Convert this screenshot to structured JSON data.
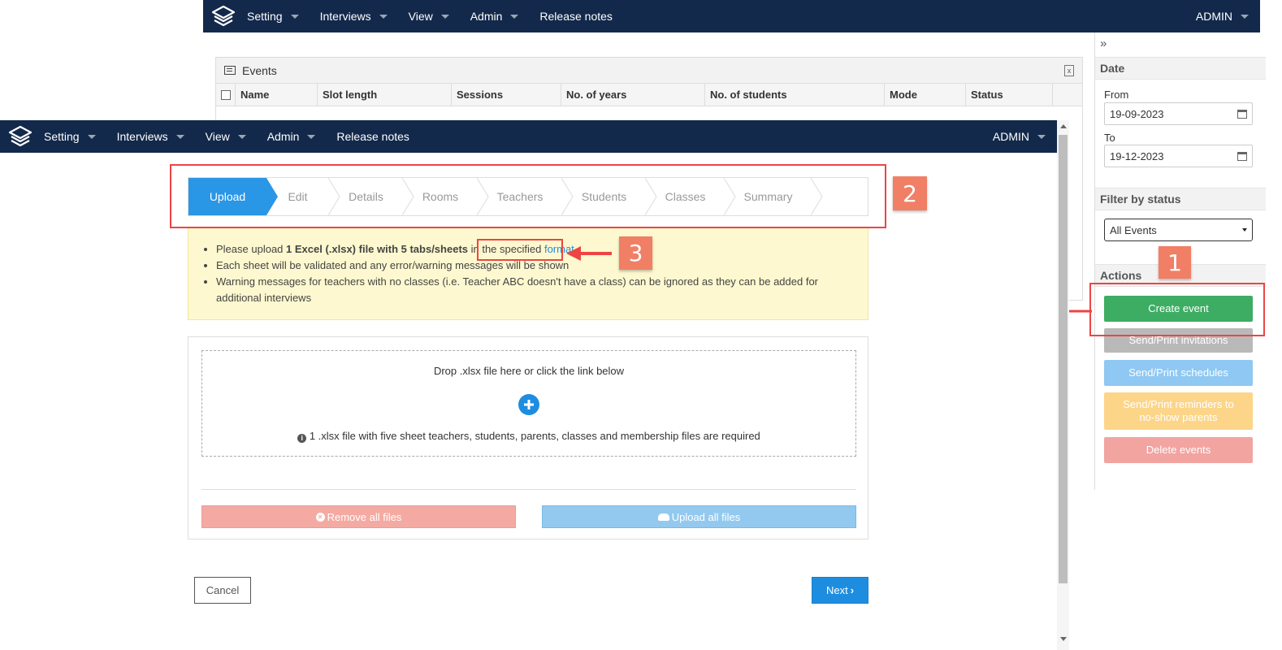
{
  "nav": {
    "items": [
      "Setting",
      "Interviews",
      "View",
      "Admin",
      "Release notes"
    ],
    "admin_label": "ADMIN"
  },
  "events": {
    "title": "Events",
    "columns": [
      "Name",
      "Slot length",
      "Sessions",
      "No. of years",
      "No. of students",
      "Mode",
      "Status"
    ]
  },
  "sidebar": {
    "collapse_glyph": "»",
    "date_heading": "Date",
    "from_label": "From",
    "from_value": "19-09-2023",
    "to_label": "To",
    "to_value": "19-12-2023",
    "filter_heading": "Filter by status",
    "filter_value": "All Events",
    "actions_heading": "Actions",
    "buttons": {
      "create": "Create event",
      "invitations": "Send/Print invitations",
      "schedules": "Send/Print schedules",
      "reminders": "Send/Print reminders to no-show parents",
      "delete": "Delete events"
    },
    "colors": {
      "create": "#3dad63",
      "invitations": "#b9b9b9",
      "schedules": "#8fc8f2",
      "reminders": "#fcd589",
      "delete": "#f2a4a1"
    }
  },
  "wizard": {
    "steps": [
      "Upload",
      "Edit",
      "Details",
      "Rooms",
      "Teachers",
      "Students",
      "Classes",
      "Summary"
    ],
    "active_step": "Upload"
  },
  "notice": {
    "line1_prefix": "Please upload ",
    "line1_bold": "1 Excel (.xlsx) file with 5 tabs/sheets",
    "line1_mid": " in the specified ",
    "line1_link": "format",
    "line2": "Each sheet will be validated and any error/warning messages will be shown",
    "line3": "Warning messages for teachers with no classes (i.e. Teacher ABC doesn't have a class) can be ignored as they can be added for additional interviews"
  },
  "upload": {
    "drop_text": "Drop .xlsx file here or click the link below",
    "info_text": "1 .xlsx file with five sheet teachers, students, parents, classes and membership files are required",
    "remove_label": "Remove all files",
    "upload_label": "Upload all files"
  },
  "footer": {
    "cancel_label": "Cancel",
    "next_label": "Next"
  },
  "annotations": {
    "badge1": "1",
    "badge2": "2",
    "badge3": "3"
  }
}
